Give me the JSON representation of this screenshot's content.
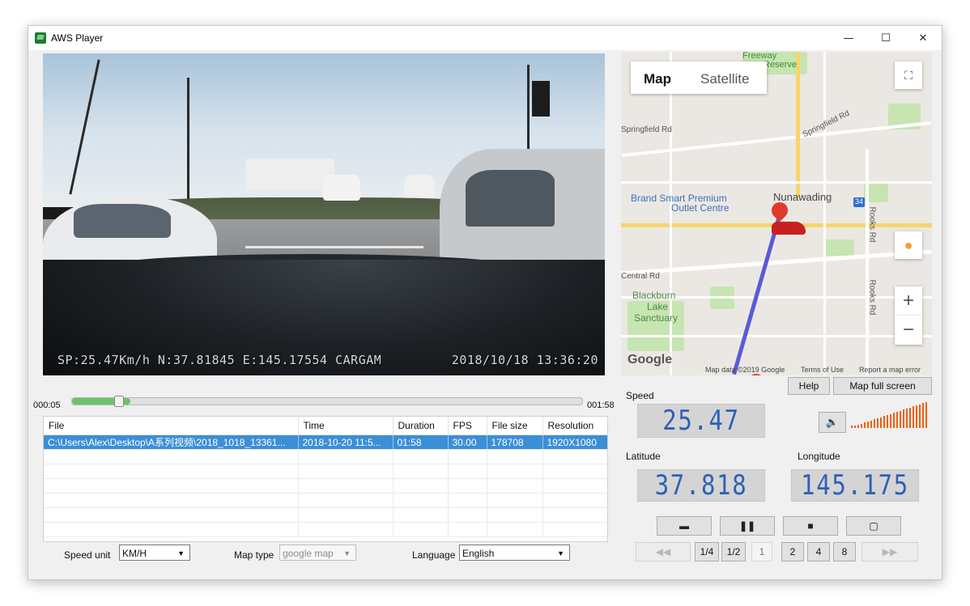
{
  "window": {
    "title": "AWS Player",
    "controls": {
      "minimize": "—",
      "maximize": "☐",
      "close": "✕"
    }
  },
  "video": {
    "overlay_left": "SP:25.47Km/h  N:37.81845  E:145.17554 CARGAM",
    "overlay_right": "2018/10/18 13:36:20"
  },
  "playback": {
    "current_time": "000:05",
    "total_time": "001:58",
    "progress_fraction": 0.05
  },
  "file_table": {
    "columns": [
      "File",
      "Time",
      "Duration",
      "FPS",
      "File size",
      "Resolution"
    ],
    "rows": [
      {
        "file": "C:\\Users\\Alex\\Desktop\\A系列视频\\2018_1018_13361...",
        "time": "2018-10-20 11:5...",
        "duration": "01:58",
        "fps": "30.00",
        "size": "178708",
        "resolution": "1920X1080",
        "selected": true
      }
    ]
  },
  "options": {
    "speed_unit_label": "Speed unit",
    "speed_unit_value": "KM/H",
    "map_type_label": "Map type",
    "map_type_value": "google map",
    "language_label": "Language",
    "language_value": "English"
  },
  "map": {
    "tab_map": "Map",
    "tab_satellite": "Satellite",
    "labels": {
      "freeway": "Freeway",
      "reserve": "Reserve",
      "springfield_left": "Springfield Rd",
      "springfield_right": "Springfield Rd",
      "brand_smart": "Brand Smart Premium",
      "outlet": "Outlet Centre",
      "nunawading": "Nunawading",
      "central": "Central Rd",
      "blackburn": "Blackburn",
      "lake": "Lake",
      "sanctuary": "Sanctuary",
      "rooks_top": "Rooks Rd",
      "rooks_bottom": "Rooks Rd",
      "route_34": "34"
    },
    "google": "Google",
    "attribution_data": "Map data ©2019 Google",
    "attribution_terms": "Terms of Use",
    "attribution_report": "Report a map error",
    "zoom_in": "+",
    "zoom_out": "−"
  },
  "panel": {
    "help_label": "Help",
    "map_full_screen_label": "Map full screen",
    "speed_label": "Speed",
    "speed_value": "25.47",
    "latitude_label": "Latitude",
    "latitude_value": "37.818",
    "longitude_label": "Longitude",
    "longitude_value": "145.175",
    "volume_level": 1.0,
    "colors": {
      "lcd_digits": "#2d5fb8",
      "volume_bars": "#f06010",
      "selection": "#3b8fd6"
    }
  },
  "controls": {
    "open_icon": "folder-icon",
    "pause_icon": "pause-icon",
    "stop_icon": "stop-icon",
    "snapshot_icon": "crop-icon",
    "rewind_icon": "rewind-icon",
    "fast_forward_icon": "fast-forward-icon",
    "speed_quarter": "1/4",
    "speed_half": "1/2",
    "speed_normal": "1",
    "speed_2x": "2",
    "speed_4x": "4",
    "speed_8x": "8"
  }
}
